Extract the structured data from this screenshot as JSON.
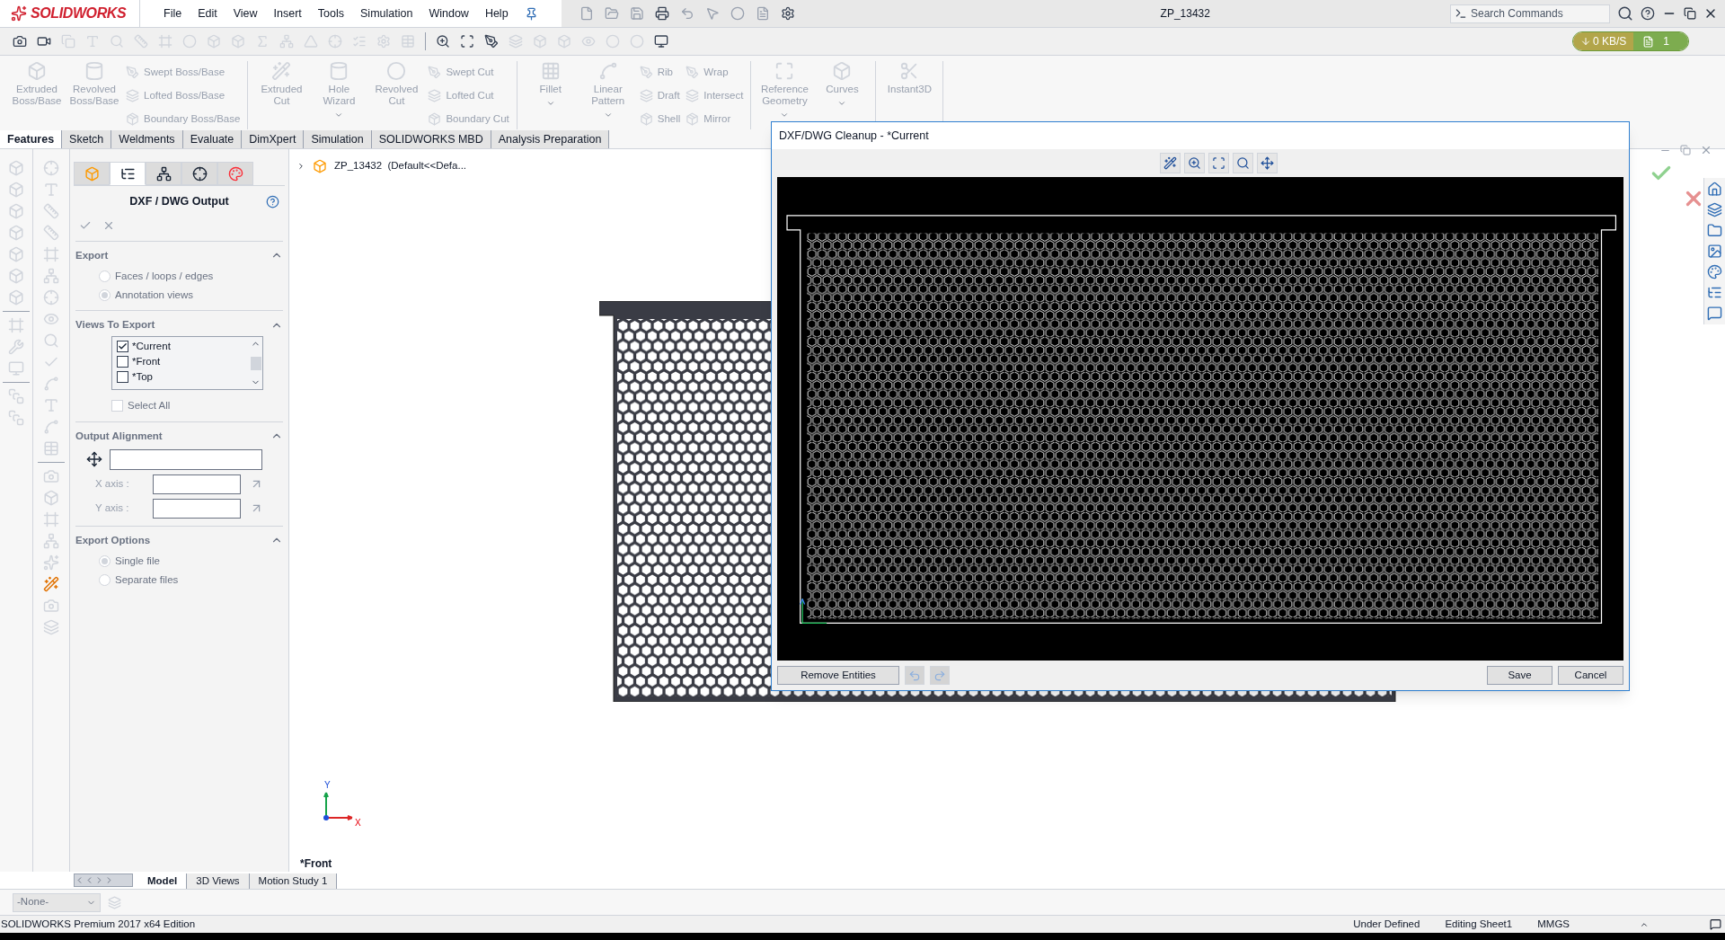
{
  "window": {
    "logo": "SOLIDWORKS",
    "title": "ZP_13432",
    "search": {
      "placeholder": "Search Commands"
    }
  },
  "menu": [
    "File",
    "Edit",
    "View",
    "Insert",
    "Tools",
    "Simulation",
    "Window",
    "Help"
  ],
  "transfer": {
    "speed": "0 KB/S",
    "count": "1"
  },
  "ribbon": {
    "disabled": true,
    "groups": [
      {
        "columns": [
          {
            "kind": "large",
            "label": "Extruded Boss/Base",
            "dropdown": false
          },
          {
            "kind": "large",
            "label": "Revolved Boss/Base",
            "dropdown": false
          },
          {
            "kind": "stack",
            "items": [
              "Swept Boss/Base",
              "Lofted Boss/Base",
              "Boundary Boss/Base"
            ]
          }
        ]
      },
      {
        "columns": [
          {
            "kind": "large",
            "label": "Extruded Cut",
            "dropdown": false
          },
          {
            "kind": "large",
            "label": "Hole Wizard",
            "dropdown": true
          },
          {
            "kind": "large",
            "label": "Revolved Cut",
            "dropdown": false
          },
          {
            "kind": "stack",
            "items": [
              "Swept Cut",
              "Lofted Cut",
              "Boundary Cut"
            ]
          }
        ]
      },
      {
        "columns": [
          {
            "kind": "large",
            "label": "Fillet",
            "dropdown": true
          },
          {
            "kind": "large",
            "label": "Linear Pattern",
            "dropdown": true
          },
          {
            "kind": "stack",
            "items": [
              "Rib",
              "Draft",
              "Shell"
            ]
          },
          {
            "kind": "stack",
            "items": [
              "Wrap",
              "Intersect",
              "Mirror"
            ]
          }
        ]
      },
      {
        "columns": [
          {
            "kind": "large",
            "label": "Reference Geometry",
            "dropdown": true
          },
          {
            "kind": "large",
            "label": "Curves",
            "dropdown": true
          }
        ]
      },
      {
        "columns": [
          {
            "kind": "large",
            "label": "Instant3D",
            "dropdown": false
          }
        ]
      }
    ]
  },
  "tabs": [
    {
      "label": "Features",
      "selected": true
    },
    {
      "label": "Sketch",
      "selected": false
    },
    {
      "label": "Weldments",
      "selected": false
    },
    {
      "label": "Evaluate",
      "selected": false
    },
    {
      "label": "DimXpert",
      "selected": false
    },
    {
      "label": "Simulation",
      "selected": false
    },
    {
      "label": "SOLIDWORKS MBD",
      "selected": false
    },
    {
      "label": "Analysis Preparation",
      "selected": false
    }
  ],
  "property_manager": {
    "tabs": [
      {
        "selected": false
      },
      {
        "selected": true
      },
      {
        "selected": false
      },
      {
        "selected": false
      },
      {
        "selected": false
      }
    ],
    "title": "DXF / DWG Output",
    "sections": [
      {
        "kind": "radios",
        "title": "Export",
        "options": [
          {
            "label": "Faces / loops / edges",
            "selected": false
          },
          {
            "label": "Annotation views",
            "selected": true
          }
        ]
      },
      {
        "kind": "views",
        "title": "Views To Export",
        "views": [
          {
            "label": "*Current",
            "checked": true
          },
          {
            "label": "*Front",
            "checked": false
          },
          {
            "label": "*Top",
            "checked": false
          }
        ],
        "select_all": {
          "label": "Select All",
          "checked": false
        }
      },
      {
        "kind": "alignment",
        "title": "Output Alignment",
        "x_label": "X axis :",
        "y_label": "Y axis :"
      },
      {
        "kind": "radios",
        "title": "Export Options",
        "options": [
          {
            "label": "Single file",
            "selected": true
          },
          {
            "label": "Separate files",
            "selected": false
          }
        ]
      }
    ]
  },
  "feature_tree": {
    "label": "ZP_13432  (Default<<Defa...",
    "expanded": false
  },
  "graphics": {
    "view_label": "*Front",
    "triad": {
      "x": "X",
      "y": "Y"
    }
  },
  "dialog": {
    "title": "DXF/DWG Cleanup - *Current",
    "remove": "Remove Entities",
    "save": "Save",
    "cancel": "Cancel"
  },
  "model_tabs": [
    {
      "label": "Model",
      "selected": true
    },
    {
      "label": "3D Views",
      "selected": false
    },
    {
      "label": "Motion Study 1",
      "selected": false
    }
  ],
  "config_select": {
    "value": "-None-"
  },
  "status_bar": {
    "edition": "SOLIDWORKS Premium 2017 x64 Edition",
    "items": [
      "Under Defined",
      "Editing Sheet1",
      "MMGS"
    ]
  }
}
